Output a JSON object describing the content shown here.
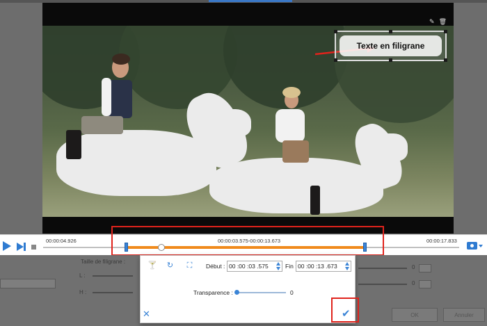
{
  "watermark": {
    "text": "Texte en filigrane"
  },
  "timeline": {
    "current_time": "00:00:04.926",
    "range_text": "00:00:03.575-00:00:13.673",
    "end_time": "00:00:17.833"
  },
  "background": {
    "size_label": "Taille de filigrane :",
    "l_label": "L :",
    "h_label": "H :",
    "l_value": "0",
    "h_value": "0",
    "ok_label": "OK",
    "cancel_label": "Annuler"
  },
  "popup": {
    "start_label": "Début :",
    "start_value": "00 :00 :03 .575",
    "end_label": "Fin :",
    "end_value": "00 :00 :13 .673",
    "transparency_label": "Transparence :",
    "transparency_value": "0"
  },
  "colors": {
    "accent": "#3b84d6",
    "range": "#f08a1c",
    "highlight": "#e0231c"
  }
}
